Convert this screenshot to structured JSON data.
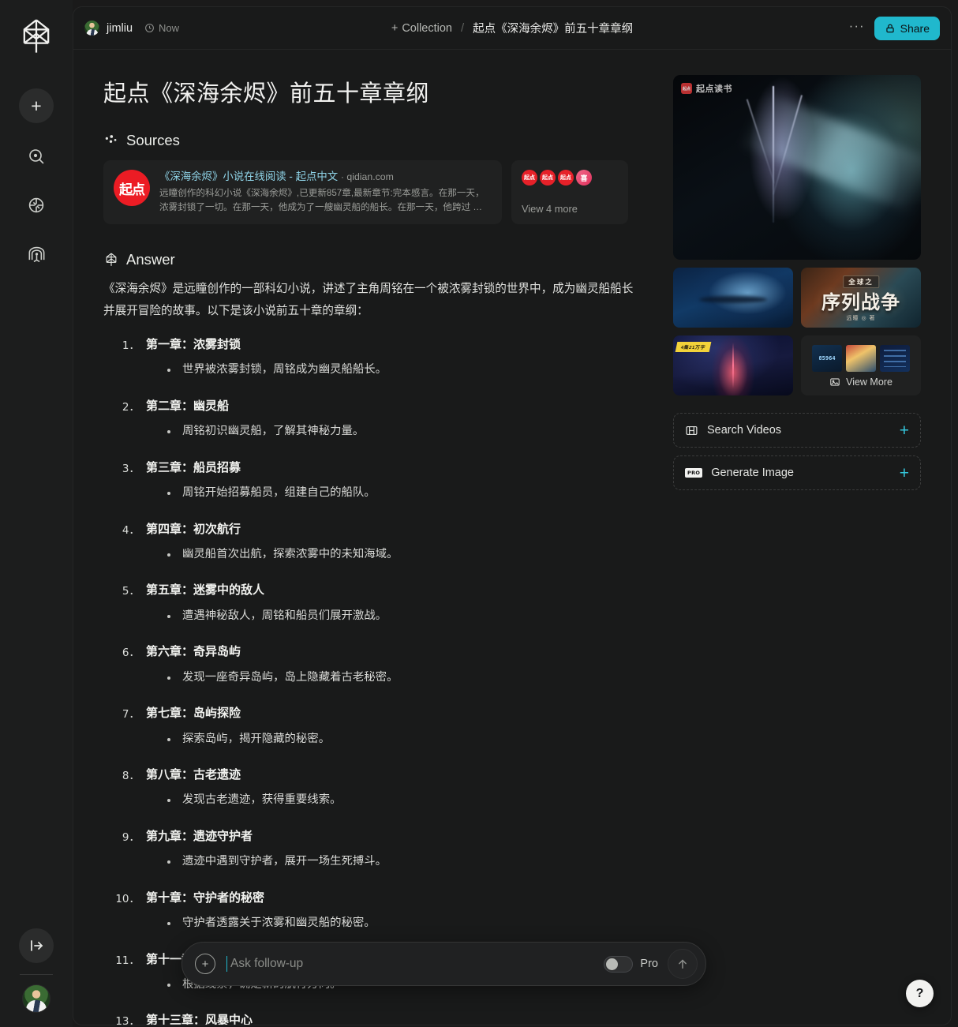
{
  "app": {
    "logo_name": "perplexity-logo"
  },
  "rail": {
    "items": [
      {
        "name": "new-thread",
        "icon": "plus-icon",
        "label": "New Thread"
      },
      {
        "name": "discover",
        "icon": "discover-icon",
        "label": "Discover"
      },
      {
        "name": "spaces",
        "icon": "spaces-icon",
        "label": "Spaces"
      },
      {
        "name": "library",
        "icon": "library-icon",
        "label": "Library"
      }
    ],
    "expand_label": "Expand sidebar",
    "expand_icon": "expand-sidebar-icon"
  },
  "topbar": {
    "username": "jimliu",
    "time": "Now",
    "time_icon": "clock-icon",
    "collection_label": "Collection",
    "collection_plus": "+",
    "separator": "/",
    "thread_title": "起点《深海余烬》前五十章章纲",
    "more_label": "···",
    "share_label": "Share",
    "share_icon": "lock-icon",
    "share_color": "#20b8cd"
  },
  "page": {
    "title": "起点《深海余烬》前五十章章纲"
  },
  "sources": {
    "heading": "Sources",
    "heading_icon": "sources-dots-icon",
    "card": {
      "favicon_text": "起点",
      "title": "《深海余烬》小说在线阅读 - 起点中文",
      "domain": "· qidian.com",
      "snippet": "远瞳创作的科幻小说《深海余烬》,已更新857章,最新章节:完本感言。在那一天，浓雾封锁了一切。在那一天，他成为了一艘幽灵船的船长。在那一天，他跨过 …"
    },
    "more": {
      "label": "View 4 more",
      "favicons": [
        "起点",
        "起点",
        "起点",
        "喜"
      ]
    }
  },
  "answer": {
    "heading": "Answer",
    "heading_icon": "perplexity-mark-icon",
    "intro": "《深海余烬》是远瞳创作的一部科幻小说，讲述了主角周铭在一个被浓雾封锁的世界中，成为幽灵船船长并展开冒险的故事。以下是该小说前五十章的章纲：",
    "chapters": [
      {
        "number": 1,
        "title": "第一章：浓雾封锁",
        "points": [
          "世界被浓雾封锁，周铭成为幽灵船船长。"
        ]
      },
      {
        "number": 2,
        "title": "第二章：幽灵船",
        "points": [
          "周铭初识幽灵船，了解其神秘力量。"
        ]
      },
      {
        "number": 3,
        "title": "第三章：船员招募",
        "points": [
          "周铭开始招募船员，组建自己的船队。"
        ]
      },
      {
        "number": 4,
        "title": "第四章：初次航行",
        "points": [
          "幽灵船首次出航，探索浓雾中的未知海域。"
        ]
      },
      {
        "number": 5,
        "title": "第五章：迷雾中的敌人",
        "points": [
          "遭遇神秘敌人，周铭和船员们展开激战。"
        ]
      },
      {
        "number": 6,
        "title": "第六章：奇异岛屿",
        "points": [
          "发现一座奇异岛屿，岛上隐藏着古老秘密。"
        ]
      },
      {
        "number": 7,
        "title": "第七章：岛屿探险",
        "points": [
          "探索岛屿，揭开隐藏的秘密。"
        ]
      },
      {
        "number": 8,
        "title": "第八章：古老遗迹",
        "points": [
          "发现古老遗迹，获得重要线索。"
        ]
      },
      {
        "number": 9,
        "title": "第九章：遗迹守护者",
        "points": [
          "遗迹中遇到守护者，展开一场生死搏斗。"
        ]
      },
      {
        "number": 10,
        "title": "第十章：守护者的秘密",
        "points": [
          "守护者透露关于浓雾和幽灵船的秘密。"
        ]
      },
      {
        "number": 11,
        "title": "第十一章：新的航向",
        "points": [
          "根据线索，确定新的航行方向。"
        ]
      }
    ],
    "partial_chapter": {
      "number": 13,
      "title": "第十三章：风暴中心"
    }
  },
  "media": {
    "hero": {
      "name": "hero-image",
      "watermark_text": "起点读书",
      "watermark_badge": "起点"
    },
    "thumbnails": [
      {
        "name": "thumb-underwater"
      },
      {
        "name": "thumb-book-cover",
        "cover_top": "全球之",
        "cover_title": "序列战争",
        "cover_author": "远瞳 ◎ 著"
      },
      {
        "name": "thumb-red-beam",
        "tag": "4集21万字"
      },
      {
        "name": "thumb-more-grid",
        "mini_label": "85964",
        "view_more": "View More",
        "view_more_icon": "image-icon"
      }
    ],
    "actions": [
      {
        "name": "search-videos",
        "label": "Search Videos",
        "icon": "video-grid-icon",
        "plus": "+"
      },
      {
        "name": "generate-image",
        "label": "Generate Image",
        "icon": "pro-badge-icon",
        "badge": "PRO",
        "plus": "+"
      }
    ],
    "accent": "#35c7dc"
  },
  "followup": {
    "placeholder": "Ask follow-up",
    "value": "",
    "plus_icon": "plus-circle-icon",
    "pro_label": "Pro",
    "pro_enabled": false,
    "send_icon": "arrow-up-icon"
  },
  "help": {
    "label": "?",
    "name": "help-button"
  }
}
